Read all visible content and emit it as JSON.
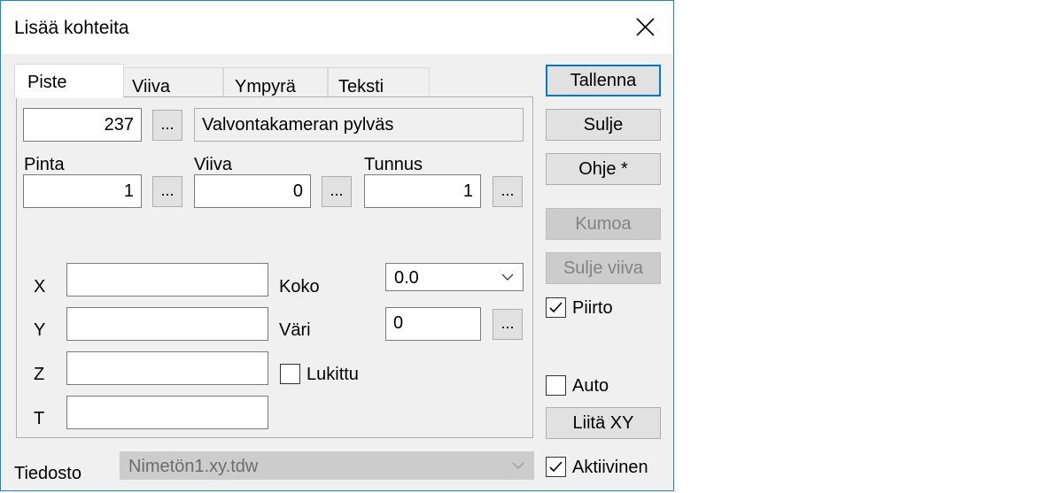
{
  "window": {
    "title": "Lisää kohteita"
  },
  "tabs": [
    {
      "label": "Piste",
      "active": true
    },
    {
      "label": "Viiva",
      "active": false
    },
    {
      "label": "Ympyrä",
      "active": false
    },
    {
      "label": "Teksti",
      "active": false
    }
  ],
  "point": {
    "number": "237",
    "description": "Valvontakameran pylväs",
    "pinta_label": "Pinta",
    "pinta_value": "1",
    "viiva_label": "Viiva",
    "viiva_value": "0",
    "tunnus_label": "Tunnus",
    "tunnus_value": "1",
    "x_label": "X",
    "x_value": "",
    "y_label": "Y",
    "y_value": "",
    "z_label": "Z",
    "z_value": "",
    "t_label": "T",
    "t_value": "",
    "koko_label": "Koko",
    "koko_value": "0.0",
    "vari_label": "Väri",
    "vari_value": "0",
    "lukittu_label": "Lukittu",
    "lukittu_checked": false,
    "dots_label": "..."
  },
  "file": {
    "label": "Tiedosto",
    "value": "Nimetön1.xy.tdw"
  },
  "buttons": {
    "tallenna": "Tallenna",
    "sulje": "Sulje",
    "ohje": "Ohje *",
    "kumoa": "Kumoa",
    "sulje_viiva": "Sulje viiva",
    "liita_xy": "Liitä XY"
  },
  "checks": {
    "piirto_label": "Piirto",
    "piirto_checked": true,
    "auto_label": "Auto",
    "auto_checked": false,
    "aktiivinen_label": "Aktiivinen",
    "aktiivinen_checked": true
  }
}
